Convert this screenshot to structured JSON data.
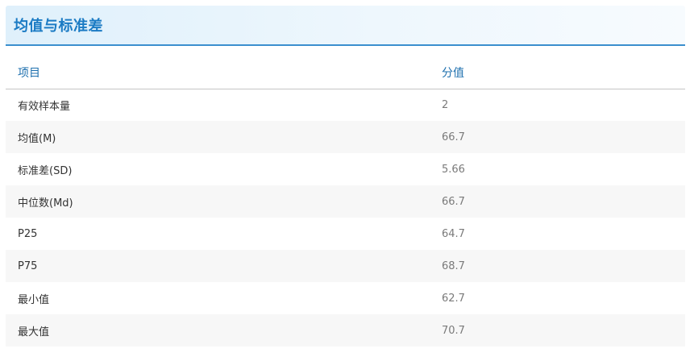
{
  "panel": {
    "title": "均值与标准差"
  },
  "table": {
    "headers": [
      "项目",
      "分值"
    ],
    "rows": [
      {
        "item": "有效样本量",
        "value": "2"
      },
      {
        "item": "均值(M)",
        "value": "66.7"
      },
      {
        "item": "标准差(SD)",
        "value": "5.66"
      },
      {
        "item": "中位数(Md)",
        "value": "66.7"
      },
      {
        "item": "P25",
        "value": "64.7"
      },
      {
        "item": "P75",
        "value": "68.7"
      },
      {
        "item": "最小值",
        "value": "62.7"
      },
      {
        "item": "最大值",
        "value": "70.7"
      }
    ]
  },
  "colors": {
    "accent": "#1b7bc4",
    "header_border": "#3b8fce",
    "stripe": "#f7f7f7"
  }
}
